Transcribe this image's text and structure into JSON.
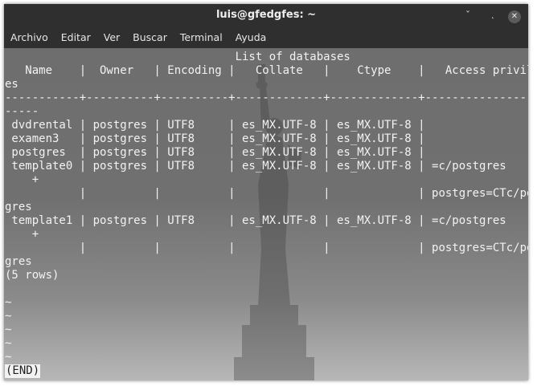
{
  "window": {
    "title": "luis@gfedgfes: ~",
    "buttons": [
      "minimize-icon",
      "maximize-icon",
      "close-icon"
    ]
  },
  "menu": [
    "Archivo",
    "Editar",
    "Ver",
    "Buscar",
    "Terminal",
    "Ayuda"
  ],
  "terminal": {
    "lines": [
      "                                  List of databases",
      "   Name    |  Owner   | Encoding |   Collate   |    Ctype    |   Access privileg",
      "es",
      "-----------+----------+----------+-------------+-------------+------------------",
      "-----",
      " dvdrental | postgres | UTF8     | es_MX.UTF-8 | es_MX.UTF-8 | ",
      " examen3   | postgres | UTF8     | es_MX.UTF-8 | es_MX.UTF-8 | ",
      " postgres  | postgres | UTF8     | es_MX.UTF-8 | es_MX.UTF-8 | ",
      " template0 | postgres | UTF8     | es_MX.UTF-8 | es_MX.UTF-8 | =c/postgres",
      "    +",
      "           |          |          |             |             | postgres=CTc/post",
      "gres",
      " template1 | postgres | UTF8     | es_MX.UTF-8 | es_MX.UTF-8 | =c/postgres",
      "    +",
      "           |          |          |             |             | postgres=CTc/post",
      "gres",
      "(5 rows)",
      "",
      "~",
      "~",
      "~",
      "~",
      "~"
    ],
    "end_marker": "(END)",
    "colors": {
      "text": "#f2f2f2",
      "titlebar": "#2f2f2f",
      "background": "#707070"
    }
  }
}
